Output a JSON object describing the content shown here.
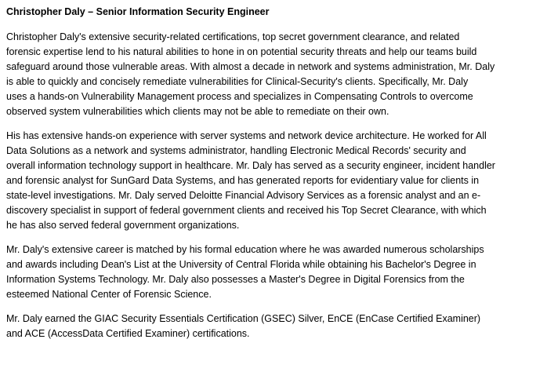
{
  "title": "Christopher Daly – Senior Information Security Engineer",
  "paragraphs": [
    {
      "lines": [
        "Christopher Daly's extensive security-related certifications, top secret government clearance, and related",
        "forensic expertise lend to his natural abilities to hone in on potential security threats and help our teams build",
        "safeguard around those vulnerable areas. With almost a decade in network and systems administration, Mr. Daly",
        "is able to quickly and concisely remediate vulnerabilities for Clinical-Security's clients. Specifically, Mr. Daly",
        "uses a hands-on Vulnerability Management process and specializes in Compensating Controls to overcome",
        "observed system vulnerabilities which clients may not be able to remediate on their own."
      ]
    },
    {
      "lines": [
        "His has extensive hands-on experience with server systems and network device architecture. He worked for All",
        "Data Solutions as a network and systems administrator, handling Electronic Medical Records' security and",
        "overall information technology support in healthcare. Mr. Daly has served as a security engineer, incident handler",
        "and forensic analyst for SunGard Data Systems, and has generated reports for evidentiary value for clients in",
        "state-level investigations. Mr. Daly served Deloitte Financial Advisory Services as a forensic analyst and an e-",
        "discovery specialist in support of federal government clients and received his Top Secret Clearance, with which",
        "he has also served federal government organizations."
      ]
    },
    {
      "lines": [
        "Mr. Daly's extensive career is matched by his formal education where he was awarded numerous scholarships",
        "and awards including Dean's List at the University of Central Florida while obtaining his Bachelor's Degree in",
        "Information Systems Technology. Mr. Daly also possesses a Master's Degree in Digital Forensics from the",
        "esteemed National Center of Forensic Science."
      ]
    },
    {
      "lines": [
        "Mr. Daly earned the GIAC Security Essentials Certification (GSEC) Silver, EnCE (EnCase Certified Examiner)",
        "and ACE (AccessData Certified Examiner) certifications."
      ]
    }
  ]
}
